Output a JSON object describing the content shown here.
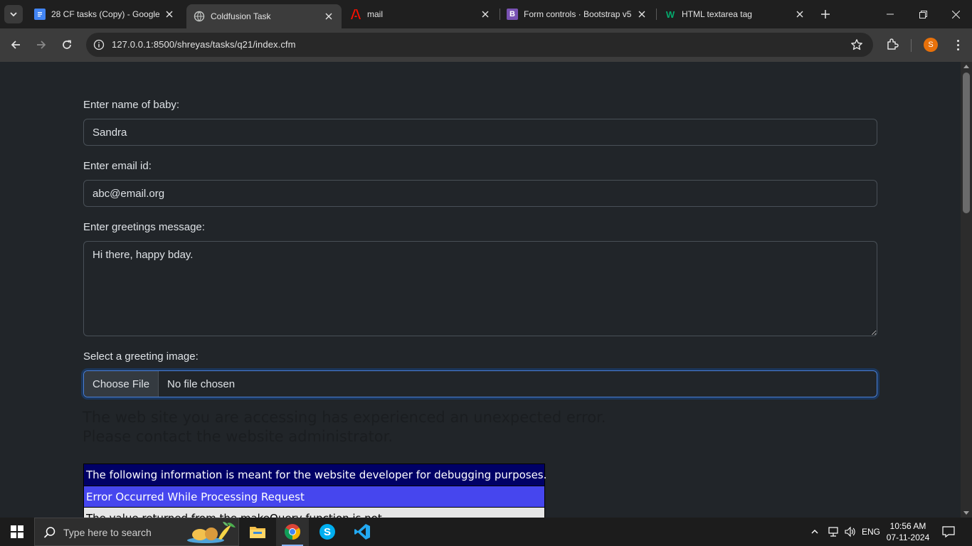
{
  "browser": {
    "tabs": [
      {
        "title": "28 CF tasks (Copy) - Google",
        "icon": "google-docs-icon",
        "color": "#4285f4"
      },
      {
        "title": "Coldfusion Task",
        "icon": "globe-icon",
        "color": "#9aa0a6",
        "active": true
      },
      {
        "title": "mail",
        "icon": "adobe-icon",
        "color": "#fa0f00"
      },
      {
        "title": "Form controls · Bootstrap v5",
        "icon": "bootstrap-icon",
        "color": "#7952b3"
      },
      {
        "title": "HTML textarea tag",
        "icon": "w3schools-icon",
        "color": "#04aa6d"
      }
    ],
    "url": "127.0.0.1:8500/shreyas/tasks/q21/index.cfm",
    "profile_initial": "S"
  },
  "form": {
    "name_label": "Enter name of baby:",
    "name_value": "Sandra",
    "email_label": "Enter email id:",
    "email_value": "abc@email.org",
    "message_label": "Enter greetings message:",
    "message_value": "Hi there, happy bday.",
    "image_label": "Select a greeting image:",
    "choose_file_label": "Choose File",
    "file_status": "No file chosen"
  },
  "error": {
    "line1": "The web site you are accessing has experienced an unexpected error.",
    "line2": "Please contact the website administrator.",
    "debug_header": "The following information is meant for the website developer for debugging purposes.",
    "title": "Error Occurred While Processing Request",
    "detail": "The value returned from the makeQuery function is not"
  },
  "taskbar": {
    "search_placeholder": "Type here to search",
    "language": "ENG",
    "time": "10:56 AM",
    "date": "07-11-2024"
  },
  "colors": {
    "page_bg": "#212529",
    "debug_header_bg": "#000066",
    "error_title_bg": "#4646ee",
    "focus_border": "#4a7fd6"
  }
}
